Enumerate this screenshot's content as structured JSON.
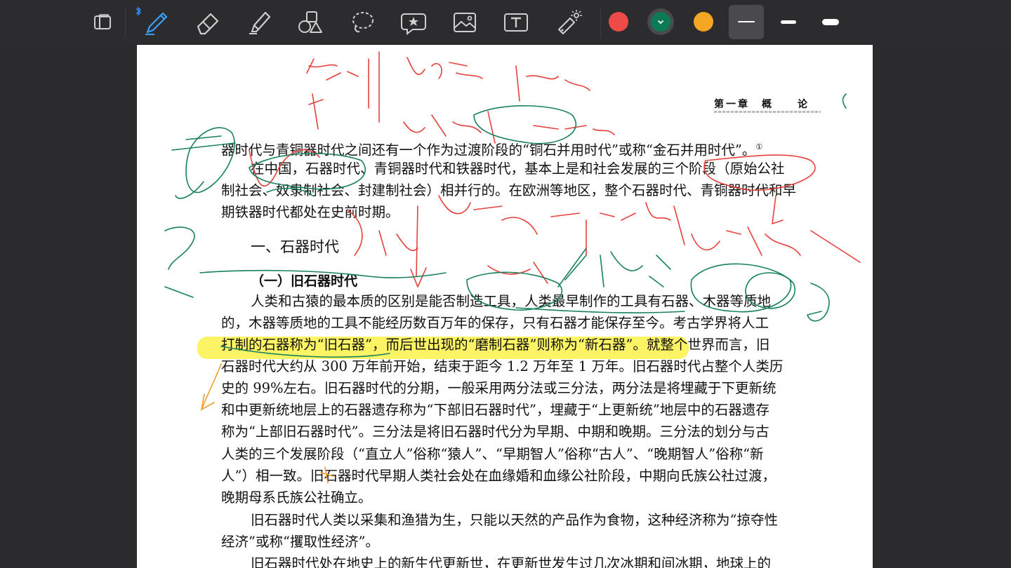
{
  "toolbar": {
    "tools": [
      {
        "name": "sidebar-toggle",
        "icon": "sidebar-icon"
      },
      {
        "name": "pen",
        "icon": "pen-icon",
        "active": true
      },
      {
        "name": "eraser",
        "icon": "eraser-icon"
      },
      {
        "name": "highlighter",
        "icon": "highlighter-icon"
      },
      {
        "name": "shapes",
        "icon": "shapes-icon"
      },
      {
        "name": "lasso",
        "icon": "lasso-icon"
      },
      {
        "name": "sticker",
        "icon": "star-icon"
      },
      {
        "name": "image",
        "icon": "image-icon"
      },
      {
        "name": "text",
        "icon": "text-icon"
      },
      {
        "name": "laser",
        "icon": "laser-pointer-icon"
      }
    ],
    "colors": [
      "#ef4a4a",
      "#0b7a55",
      "#f5a623"
    ],
    "selected_color": "#0b7a55",
    "strokes": [
      "thin",
      "medium",
      "thick"
    ],
    "selected_stroke": "thin"
  },
  "document": {
    "chapter_header": "第一章　概　　论",
    "lines": [
      "器时代与青铜器时代之间还有一个作为过渡阶段的“铜石并用时代”或称“金石并用时代”。",
      "在中国，石器时代、青铜器时代和铁器时代，基本上是和社会发展的三个阶段（原始公社",
      "制社会、奴隶制社会、封建制社会）相并行的。在欧洲等地区，整个石器时代、青铜器时代和早",
      "期铁器时代都处在史前时期。"
    ],
    "footnote_mark": "①",
    "heading1": "一、石器时代",
    "heading2": "（一）旧石器时代",
    "body": [
      "人类和古猿的最本质的区别是能否制造工具，人类最早制作的工具有石器、木器等质地",
      "的，木器等质地的工具不能经历数百万年的保存，只有石器才能保存至今。考古学界将人工",
      "打制的石器称为“旧石器”，而后世出现的“磨制石器”则称为“新石器”。就整个世界而言，旧",
      "石器时代大约从 300 万年前开始，结束于距今 1.2 万年至 1 万年。旧石器时代占整个人类历",
      "史的 99%左右。旧石器时代的分期，一般采用两分法或三分法，两分法是将埋藏于下更新统",
      "和中更新统地层上的石器遗存称为“下部旧石器时代”，埋藏于“上更新统”地层中的石器遗存",
      "称为“上部旧石器时代”。三分法是将旧石器时代分为早期、中期和晚期。三分法的划分与古",
      "人类的三个发展阶段（“直立人”俗称“猿人”、“早期智人”俗称“古人”、“晚期智人”俗称“新",
      "人”）相一致。旧石器时代早期人类社会处在血缘婚和血缘公社阶段，中期向氏族公社过渡，",
      "晚期母系氏族公社确立。",
      "旧石器时代人类以采集和渔猎为生，只能以天然的产品作为食物，这种经济称为“掠夺性",
      "经济”或称“攫取性经济”。",
      "旧石器时代处在地史上的新生代更新世，在更新世发生过几次冰期和间冰期，地球上的"
    ]
  }
}
